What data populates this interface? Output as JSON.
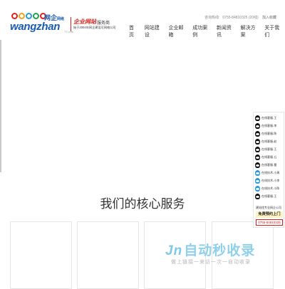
{
  "header": {
    "logo": {
      "cn": "网企",
      "cn_small": "网络",
      "word": "wangzhan",
      "sub": "TT.com",
      "tag_main": "企业网站",
      "tag_service": "服务商",
      "tag_desc": "始于2004年网企建设可网络公司",
      "ring_colors": [
        "#e02020",
        "#f0a020",
        "#2a9ad8",
        "#20a050",
        "#e02020"
      ]
    },
    "hotline_label": "咨询热线:",
    "hotline_number": "0755-84810325 (20线)",
    "favorite": "加入收藏",
    "nav": [
      "首页",
      "网站建设",
      "企业邮箱",
      "成功案例",
      "新闻资讯",
      "解决方案",
      "关于我们"
    ]
  },
  "main": {
    "section_title": "我们的核心服务"
  },
  "side_panel": {
    "items": [
      {
        "label": "在线客服-王"
      },
      {
        "label": "在线客服-李"
      },
      {
        "label": "在线客服-陈"
      },
      {
        "label": "在线客服-赵"
      },
      {
        "label": "在线客服-王"
      },
      {
        "label": "在线客服-丘"
      },
      {
        "label": "在线客服-雷"
      },
      {
        "label": "在线技术-小周"
      },
      {
        "label": "在线技术-小李"
      },
      {
        "label": "在线技术-小陈"
      },
      {
        "label": "在线客服-王"
      }
    ],
    "note": "建站找专业网企公司",
    "cta": "免费预约上门",
    "phone": "0755-84810325"
  },
  "watermark": {
    "logo": "自动秒收录",
    "logo_mark": "Jn",
    "sub": "做上链接一来访一次一自动收录"
  }
}
